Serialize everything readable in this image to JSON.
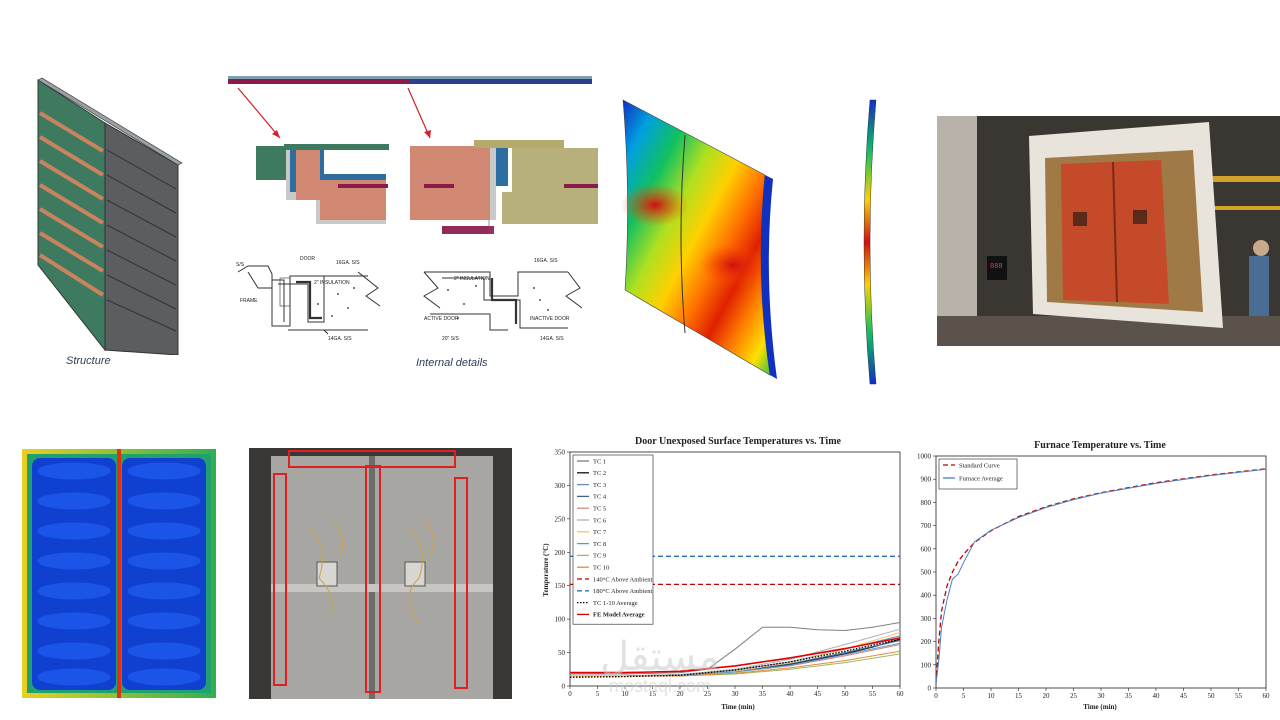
{
  "captions": {
    "structure": "Structure",
    "internal": "Internal details"
  },
  "drawing_labels": {
    "left_a": "DOOR",
    "left_b": "16GA. S/S",
    "left_c": "2\" INSULATION",
    "left_d": "FRAME",
    "left_e": "S/S",
    "left_f": "14GA. S/S",
    "right_a": "16GA. S/S",
    "right_b": "2\" INSULATION",
    "right_c": "ACTIVE DOOR",
    "right_d": "INACTIVE DOOR",
    "right_e": "14GA. S/S",
    "right_f": "20\" S/S"
  },
  "photo_test": {
    "display_text": "888"
  },
  "watermark": {
    "arabic": "مستقل",
    "latin": "mostaql.com"
  },
  "colors": {
    "green_panel": "#3d7a60",
    "dark_panel": "#555a5c",
    "red": "#c00000",
    "blue": "#2e6db5"
  },
  "chart_data": [
    {
      "type": "line",
      "title": "Door Unexposed Surface Temperatures vs. Time",
      "xlabel": "Time (min)",
      "ylabel": "Temperature (°C)",
      "xlim": [
        0,
        60
      ],
      "ylim": [
        0,
        350
      ],
      "xticks": [
        0,
        5,
        10,
        15,
        20,
        25,
        30,
        35,
        40,
        45,
        50,
        55,
        60
      ],
      "yticks": [
        0,
        50,
        100,
        150,
        200,
        250,
        300,
        350
      ],
      "grid": false,
      "legend_position": "top-left",
      "series": [
        {
          "name": "TC 1",
          "color": "#7f7f7f",
          "dash": "",
          "x": [
            0,
            10,
            20,
            25,
            30,
            35,
            40,
            45,
            50,
            55,
            60
          ],
          "y": [
            18,
            18,
            20,
            25,
            55,
            88,
            88,
            84,
            83,
            88,
            95
          ]
        },
        {
          "name": "TC 2",
          "color": "#111111",
          "dash": "",
          "x": [
            0,
            10,
            20,
            30,
            40,
            50,
            55,
            60
          ],
          "y": [
            15,
            15,
            17,
            22,
            32,
            48,
            58,
            70
          ]
        },
        {
          "name": "TC 3",
          "color": "#6e8fb5",
          "dash": "",
          "x": [
            0,
            10,
            20,
            30,
            40,
            50,
            60
          ],
          "y": [
            15,
            15,
            17,
            24,
            36,
            55,
            75
          ]
        },
        {
          "name": "TC 4",
          "color": "#3d5f8a",
          "dash": "",
          "x": [
            0,
            10,
            20,
            30,
            40,
            50,
            60
          ],
          "y": [
            15,
            15,
            16,
            22,
            33,
            50,
            68
          ]
        },
        {
          "name": "TC 5",
          "color": "#d98880",
          "dash": "",
          "x": [
            0,
            10,
            20,
            30,
            40,
            50,
            60
          ],
          "y": [
            15,
            15,
            16,
            21,
            30,
            45,
            62
          ]
        },
        {
          "name": "TC 6",
          "color": "#b0b0b0",
          "dash": "",
          "x": [
            0,
            10,
            20,
            30,
            40,
            50,
            60
          ],
          "y": [
            15,
            15,
            17,
            25,
            40,
            62,
            85
          ]
        },
        {
          "name": "TC 7",
          "color": "#f2c46b",
          "dash": "",
          "x": [
            0,
            10,
            20,
            30,
            40,
            50,
            60
          ],
          "y": [
            15,
            15,
            16,
            22,
            35,
            55,
            80
          ]
        },
        {
          "name": "TC 8",
          "color": "#5b9bd5",
          "dash": "",
          "x": [
            0,
            10,
            20,
            30,
            40,
            50,
            60
          ],
          "y": [
            15,
            15,
            16,
            21,
            31,
            47,
            64
          ]
        },
        {
          "name": "TC 9",
          "color": "#9bbb59",
          "dash": "",
          "x": [
            0,
            10,
            20,
            30,
            40,
            50,
            60
          ],
          "y": [
            15,
            15,
            15,
            18,
            25,
            35,
            48
          ]
        },
        {
          "name": "TC 10",
          "color": "#e28b3b",
          "dash": "",
          "x": [
            0,
            10,
            20,
            30,
            40,
            50,
            60
          ],
          "y": [
            15,
            15,
            15,
            19,
            27,
            38,
            52
          ]
        },
        {
          "name": "140°C Above Ambient",
          "color": "#c00000",
          "dash": "5,3",
          "x": [
            0,
            60
          ],
          "y": [
            152,
            152
          ]
        },
        {
          "name": "180°C Above Ambient",
          "color": "#2e6db5",
          "dash": "5,3",
          "x": [
            0,
            60
          ],
          "y": [
            194,
            194
          ]
        },
        {
          "name": "TC 1-10 Average",
          "color": "#000000",
          "dash": "1.5,1.5",
          "x": [
            0,
            10,
            20,
            30,
            40,
            50,
            60
          ],
          "y": [
            13,
            14,
            16,
            24,
            36,
            52,
            70
          ]
        },
        {
          "name": "FE Model Average",
          "color": "#e00000",
          "dash": "",
          "x": [
            0,
            10,
            20,
            30,
            40,
            50,
            60
          ],
          "y": [
            20,
            20,
            22,
            30,
            42,
            56,
            72
          ]
        }
      ]
    },
    {
      "type": "line",
      "title": "Furnace Temperature vs. Time",
      "xlabel": "Time (min)",
      "ylabel": "",
      "xlim": [
        0,
        60
      ],
      "ylim": [
        0,
        1000
      ],
      "xticks": [
        0,
        5,
        10,
        15,
        20,
        25,
        30,
        35,
        40,
        45,
        50,
        55,
        60
      ],
      "yticks": [
        0,
        100,
        200,
        300,
        400,
        500,
        600,
        700,
        800,
        900,
        1000
      ],
      "grid": false,
      "legend_position": "top-left",
      "series": [
        {
          "name": "Standard Curve",
          "color": "#c00000",
          "dash": "5,3",
          "x": [
            0,
            0.5,
            1,
            2,
            3,
            4,
            5,
            7,
            10,
            15,
            20,
            25,
            30,
            40,
            50,
            60
          ],
          "y": [
            20,
            200,
            330,
            440,
            500,
            545,
            576,
            627,
            678,
            739,
            781,
            815,
            842,
            885,
            918,
            945
          ]
        },
        {
          "name": "Furnace Average",
          "color": "#4a7fc1",
          "dash": "",
          "x": [
            0,
            0.5,
            1,
            2,
            3,
            4,
            5,
            7,
            10,
            15,
            20,
            25,
            30,
            40,
            50,
            60
          ],
          "y": [
            20,
            120,
            260,
            380,
            470,
            490,
            540,
            630,
            680,
            735,
            778,
            812,
            840,
            882,
            916,
            943
          ]
        }
      ]
    }
  ]
}
